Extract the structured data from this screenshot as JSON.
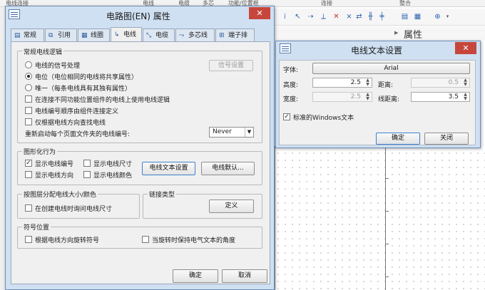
{
  "background": {
    "ribbon_labels": [
      "电线连接",
      "电线",
      "电缆",
      "多芯",
      "功能/位置框",
      "连接",
      "整合"
    ],
    "properties_title": "属性"
  },
  "main_dialog": {
    "title": "电路图(EN) 属性",
    "close_glyph": "✕",
    "tabs": [
      "常规",
      "引用",
      "线圈",
      "电线",
      "电缆",
      "多芯线",
      "端子排"
    ],
    "active_tab_index": 3,
    "group_logic": {
      "label": "常规电线逻辑",
      "radio_signal": "电线的信号处理",
      "signal_button": "信号设置",
      "radio_potential": "电位（电位相同的电线将共享属性）",
      "radio_unique": "唯一（每条电线具有其独有属性）",
      "chk_cross_function": "在连接不同功能位置组件的电线上使用电线逻辑",
      "chk_order": "电线编号顺序由组件连接定义",
      "chk_direction": "仅根据电线方向查找电线",
      "restart_label": "重新启动每个页面文件夹的电线编号:",
      "restart_value": "Never"
    },
    "group_graphic": {
      "label": "图形化行为",
      "chk_show_number": "显示电线编号",
      "chk_show_size": "显示电线尺寸",
      "chk_show_direction": "显示电线方向",
      "chk_show_color": "显示电线颜色",
      "text_settings_button": "电线文本设置",
      "defaults_button": "电线默认..."
    },
    "group_layer": {
      "label": "按图层分配电线大小/颜色",
      "chk_ask": "在创建电线时询问电线尺寸"
    },
    "group_link": {
      "label": "链接类型",
      "define_button": "定义"
    },
    "group_symbol": {
      "label": "符号位置",
      "chk_rotate": "根据电线方向旋转符号",
      "chk_keep_angle": "当旋转时保持电气文本的角度"
    },
    "ok_button": "确定",
    "cancel_button": "取消"
  },
  "text_dialog": {
    "title": "电线文本设置",
    "close_glyph": "✕",
    "font_label": "字体:",
    "font_value": "Arial",
    "height_label": "高度:",
    "height_value": "2.5",
    "distance_label": "距离:",
    "distance_value": "0.5",
    "width_label": "宽度:",
    "width_value": "2.5",
    "line_distance_label": "线距离:",
    "line_distance_value": "3.5",
    "chk_windows_text": "标准的Windows文本",
    "ok_button": "确定",
    "close_button": "关闭"
  }
}
